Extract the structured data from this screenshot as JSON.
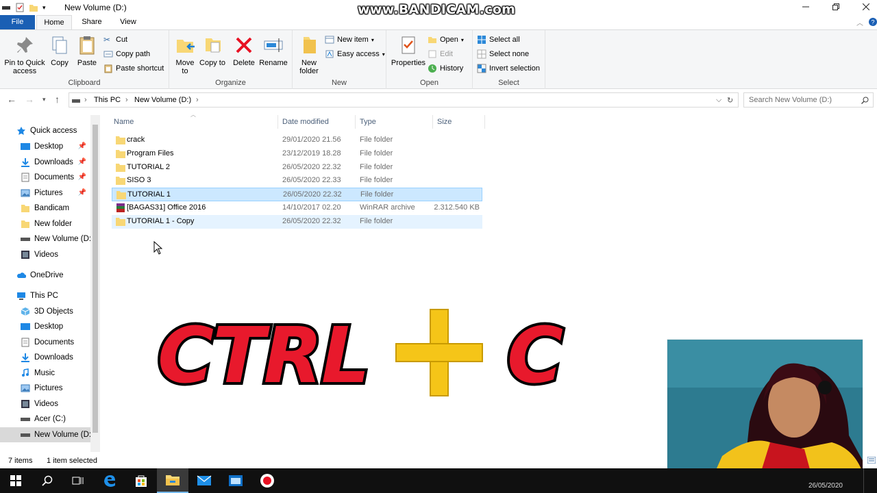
{
  "window": {
    "title": "New Volume (D:)"
  },
  "watermark": "www.BANDICAM.com",
  "tabs": {
    "file": "File",
    "home": "Home",
    "share": "Share",
    "view": "View"
  },
  "ribbon": {
    "clipboard": {
      "label": "Clipboard",
      "pin": "Pin to Quick access",
      "copy": "Copy",
      "paste": "Paste",
      "cut": "Cut",
      "copy_path": "Copy path",
      "paste_shortcut": "Paste shortcut"
    },
    "organize": {
      "label": "Organize",
      "move_to": "Move to",
      "copy_to": "Copy to",
      "delete": "Delete",
      "rename": "Rename"
    },
    "new": {
      "label": "New",
      "new_folder": "New folder",
      "new_item": "New item",
      "easy_access": "Easy access"
    },
    "open": {
      "label": "Open",
      "properties": "Properties",
      "open": "Open",
      "edit": "Edit",
      "history": "History"
    },
    "select": {
      "label": "Select",
      "select_all": "Select all",
      "select_none": "Select none",
      "invert": "Invert selection"
    }
  },
  "address": {
    "crumb1": "This PC",
    "crumb2": "New Volume (D:)",
    "search_placeholder": "Search New Volume (D:)"
  },
  "nav": {
    "quick_access": "Quick access",
    "quick_items": [
      {
        "label": "Desktop"
      },
      {
        "label": "Downloads"
      },
      {
        "label": "Documents"
      },
      {
        "label": "Pictures"
      },
      {
        "label": "Bandicam"
      },
      {
        "label": "New folder"
      },
      {
        "label": "New Volume (D:"
      },
      {
        "label": "Videos"
      }
    ],
    "onedrive": "OneDrive",
    "this_pc": "This PC",
    "pc_items": [
      {
        "label": "3D Objects"
      },
      {
        "label": "Desktop"
      },
      {
        "label": "Documents"
      },
      {
        "label": "Downloads"
      },
      {
        "label": "Music"
      },
      {
        "label": "Pictures"
      },
      {
        "label": "Videos"
      },
      {
        "label": "Acer (C:)"
      },
      {
        "label": "New Volume (D:"
      }
    ]
  },
  "columns": {
    "name": "Name",
    "date": "Date modified",
    "type": "Type",
    "size": "Size"
  },
  "files": [
    {
      "name": "crack",
      "date": "29/01/2020 21.56",
      "type": "File folder",
      "size": ""
    },
    {
      "name": "Program Files",
      "date": "23/12/2019 18.28",
      "type": "File folder",
      "size": ""
    },
    {
      "name": "TUTORIAL 2",
      "date": "26/05/2020 22.32",
      "type": "File folder",
      "size": ""
    },
    {
      "name": "SISO 3",
      "date": "26/05/2020 22.33",
      "type": "File folder",
      "size": ""
    },
    {
      "name": "TUTORIAL 1",
      "date": "26/05/2020 22.32",
      "type": "File folder",
      "size": ""
    },
    {
      "name": "[BAGAS31] Office 2016",
      "date": "14/10/2017 02.20",
      "type": "WinRAR archive",
      "size": "2.312.540 KB"
    },
    {
      "name": "TUTORIAL 1 - Copy",
      "date": "26/05/2020 22.32",
      "type": "File folder",
      "size": ""
    }
  ],
  "status": {
    "items": "7 items",
    "selected": "1 item selected"
  },
  "overlay": {
    "text_left": "CTRL",
    "plus": "+",
    "text_right": "C"
  },
  "clock": "26/05/2020",
  "colors": {
    "accent": "#1a5fb4",
    "selection": "#cce8ff",
    "folder": "#f8d775",
    "overlay_red": "#e8192c",
    "overlay_yellow": "#f5c518"
  }
}
